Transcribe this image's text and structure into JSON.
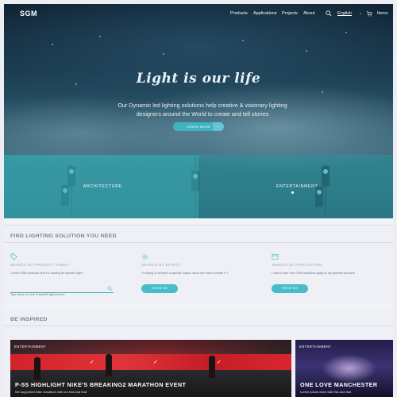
{
  "nav": {
    "logo": "SGM",
    "links": [
      "Products",
      "Applications",
      "Projects",
      "About"
    ],
    "language": "English",
    "cart_separator": "(0)",
    "items_label": "Items"
  },
  "hero": {
    "title": "Light is our life",
    "subtitle": "Our Dynamic led lighting solutions help creative & visionary lighting designers around the World to create and tell stories",
    "cta_label": "LEARN MORE",
    "cta_arrow": "→",
    "categories": [
      "ARCHITECTURE",
      "ENTERTAINMENT"
    ]
  },
  "find": {
    "title": "FIND LIGHTING SOLUTION YOU NEED",
    "columns": [
      {
        "icon": "tag-icon",
        "title": "SEARCH BY PRODUCT FAMILY",
        "text": "I know GSM products and I'm looking for specific light ! ",
        "input_placeholder": "Type name or code of specific light product"
      },
      {
        "icon": "sun-icon",
        "title": "SEARCH BY EFFECT",
        "text": "I'm trying to achieve a specific output, show me how to create it ?",
        "button": "SHOW ME"
      },
      {
        "icon": "window-icon",
        "title": "SEARCH BY APPLICATION",
        "text": "I want to see how GSM solutions apply to my specific scenario",
        "button": "SHOW ME"
      }
    ]
  },
  "inspired": {
    "title": "BE INSPIRED",
    "cards": [
      {
        "tag": "ENTERTAINMENT",
        "title": "P-5S HIGHLIGHT NIKE'S BREAKING2 MARATHON EVENT",
        "desc": "We supported Nike marathon with our this and that"
      },
      {
        "tag": "ENTERTAINMENT",
        "title": "ONE LOVE MANCHESTER",
        "desc": "Lorem ipsum dolor with this and that"
      }
    ]
  },
  "colors": {
    "accent": "#48bcc8",
    "teal_overlay": "#34aab4",
    "nike_red": "#d2222a"
  }
}
